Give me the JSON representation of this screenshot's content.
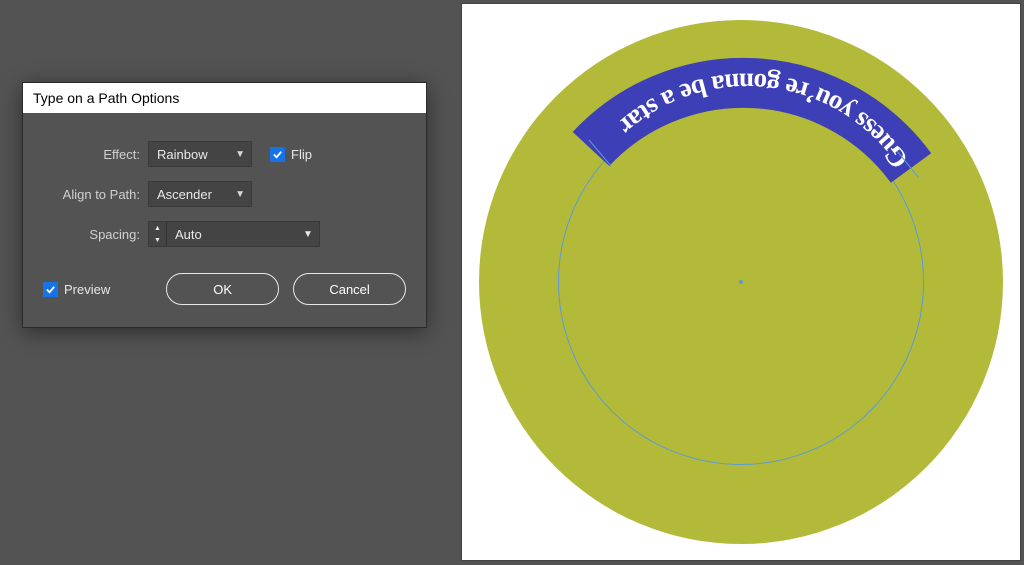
{
  "dialog": {
    "title": "Type on a Path Options",
    "effect": {
      "label": "Effect:",
      "value": "Rainbow"
    },
    "flip": {
      "label": "Flip",
      "checked": true
    },
    "align": {
      "label": "Align to Path:",
      "value": "Ascender"
    },
    "spacing": {
      "label": "Spacing:",
      "value": "Auto"
    },
    "preview": {
      "label": "Preview",
      "checked": true
    },
    "ok": "OK",
    "cancel": "Cancel"
  },
  "artwork": {
    "text": "Guess you’re gonna be a star"
  }
}
